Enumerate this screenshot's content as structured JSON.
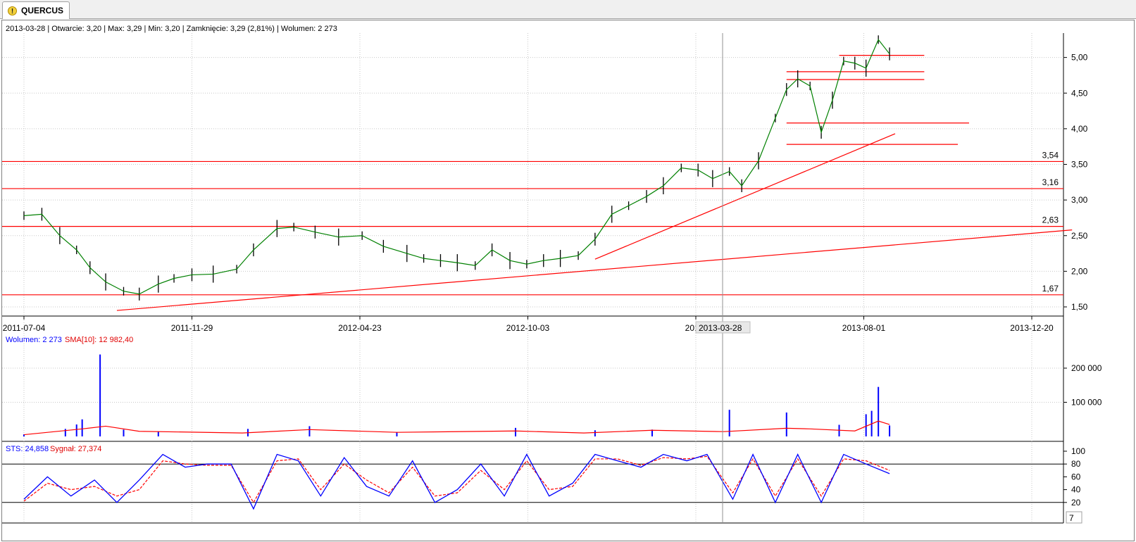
{
  "tab": {
    "label": "QUERCUS",
    "icon": "warning-icon"
  },
  "header": {
    "price": "2013-03-28 | Otwarcie: 3,20 | Max: 3,29 | Min: 3,20 | Zamknięcie: 3,29 (2,81%)  | Wolumen: 2 273",
    "volume_name": "Wolumen: 2 273",
    "volume_sma": "SMA[10]: 12 982,40",
    "sts_name": "STS: 24,858",
    "sts_signal": "Sygnał: 27,374"
  },
  "crosshair": {
    "date": "2013-03-28",
    "corner_value": "7"
  },
  "colors": {
    "candle": "#000000",
    "sma": "#008000",
    "line": "#ff0000",
    "volume": "#0000ff",
    "grid": "#c8c8c8"
  },
  "chart_data": [
    {
      "type": "line",
      "name": "price",
      "x_ticks": [
        "2011-07-04",
        "2011-11-29",
        "2012-04-23",
        "2012-10-03",
        "2013-",
        "2013-08-01",
        "2013-12-20"
      ],
      "y_ticks": [
        "1,50",
        "2,00",
        "2,50",
        "3,00",
        "3,50",
        "4,00",
        "4,50",
        "5,00"
      ],
      "ylim": [
        1.42,
        5.38
      ],
      "levels": [
        {
          "value": 3.54,
          "label": "3,54"
        },
        {
          "value": 3.16,
          "label": "3,16"
        },
        {
          "value": 2.63,
          "label": "2,63"
        },
        {
          "value": 1.67,
          "label": "1,67"
        }
      ],
      "short_levels": [
        {
          "value": 5.03,
          "from": "2013-07-01",
          "to": "2013-09-15"
        },
        {
          "value": 4.8,
          "from": "2013-05-15",
          "to": "2013-09-15"
        },
        {
          "value": 4.69,
          "from": "2013-05-15",
          "to": "2013-09-15"
        },
        {
          "value": 4.08,
          "from": "2013-05-15",
          "to": "2013-10-25"
        },
        {
          "value": 3.78,
          "from": "2013-05-15",
          "to": "2013-10-15"
        }
      ],
      "trendlines": [
        {
          "from": [
            "2011-09-25",
            1.45
          ],
          "to": [
            "2014-01-25",
            2.58
          ]
        },
        {
          "from": [
            "2012-11-25",
            2.17
          ],
          "to": [
            "2013-08-20",
            3.93
          ]
        }
      ],
      "series": [
        {
          "dates": [
            "2011-07-04",
            "2011-07-20",
            "2011-08-05",
            "2011-08-20",
            "2011-09-01",
            "2011-09-15",
            "2011-10-01",
            "2011-10-15",
            "2011-11-01",
            "2011-11-15",
            "2011-12-01",
            "2011-12-20",
            "2012-01-10",
            "2012-01-25",
            "2012-02-15",
            "2012-03-01",
            "2012-03-20",
            "2012-04-10",
            "2012-05-01",
            "2012-05-20",
            "2012-06-10",
            "2012-06-25",
            "2012-07-10",
            "2012-07-25",
            "2012-08-10",
            "2012-08-25",
            "2012-09-10",
            "2012-09-25",
            "2012-10-10",
            "2012-10-25",
            "2012-11-10",
            "2012-11-25",
            "2012-12-10",
            "2012-12-25",
            "2013-01-10",
            "2013-01-25",
            "2013-02-10",
            "2013-02-25",
            "2013-03-10",
            "2013-03-25",
            "2013-04-05",
            "2013-04-20",
            "2013-05-05",
            "2013-05-15",
            "2013-05-25",
            "2013-06-05",
            "2013-06-15",
            "2013-06-25",
            "2013-07-05",
            "2013-07-15",
            "2013-07-25",
            "2013-08-05",
            "2013-08-15"
          ],
          "values": [
            2.78,
            2.8,
            2.5,
            2.3,
            2.05,
            1.85,
            1.72,
            1.68,
            1.82,
            1.9,
            1.95,
            1.96,
            2.03,
            2.3,
            2.6,
            2.62,
            2.55,
            2.48,
            2.5,
            2.35,
            2.25,
            2.18,
            2.15,
            2.12,
            2.08,
            2.3,
            2.15,
            2.1,
            2.15,
            2.18,
            2.22,
            2.45,
            2.8,
            2.92,
            3.05,
            3.2,
            3.45,
            3.42,
            3.3,
            3.4,
            3.2,
            3.55,
            4.15,
            4.55,
            4.7,
            4.6,
            3.95,
            4.4,
            4.95,
            4.92,
            4.85,
            5.25,
            5.05
          ]
        }
      ]
    },
    {
      "type": "bar",
      "name": "Wolumen",
      "y_ticks": [
        "100 000",
        "200 000"
      ],
      "ylim": [
        0,
        240000
      ],
      "series": [
        {
          "name": "Wolumen",
          "dates": [
            "2011-07-04",
            "2011-08-10",
            "2011-08-20",
            "2011-08-25",
            "2011-09-10",
            "2011-10-01",
            "2011-11-01",
            "2012-01-20",
            "2012-03-15",
            "2012-06-01",
            "2012-09-15",
            "2012-11-25",
            "2013-01-15",
            "2013-03-25",
            "2013-05-15",
            "2013-07-01",
            "2013-07-25",
            "2013-07-30",
            "2013-08-05",
            "2013-08-15"
          ],
          "values": [
            6000,
            22000,
            35000,
            50000,
            240000,
            20000,
            15000,
            22000,
            30000,
            12000,
            25000,
            18000,
            20000,
            78000,
            70000,
            34000,
            65000,
            75000,
            145000,
            32000
          ]
        },
        {
          "name": "SMA[10]",
          "dates": [
            "2011-07-04",
            "2011-08-25",
            "2011-09-15",
            "2011-10-15",
            "2012-01-15",
            "2012-03-15",
            "2012-06-01",
            "2012-09-15",
            "2012-11-15",
            "2013-01-15",
            "2013-03-20",
            "2013-05-15",
            "2013-06-05",
            "2013-07-15",
            "2013-08-05",
            "2013-08-15"
          ],
          "values": [
            5000,
            22000,
            30000,
            15000,
            10000,
            20000,
            12000,
            16000,
            10000,
            18000,
            14000,
            24000,
            22000,
            16000,
            45000,
            35000
          ]
        }
      ]
    },
    {
      "type": "line",
      "name": "STS",
      "y_ticks": [
        "20",
        "40",
        "60",
        "80",
        "100"
      ],
      "ylim": [
        -2,
        107
      ],
      "reference_lines": [
        20,
        80
      ],
      "series": [
        {
          "name": "STS",
          "dates": [
            "2011-07-04",
            "2011-07-25",
            "2011-08-15",
            "2011-09-05",
            "2011-09-25",
            "2011-10-15",
            "2011-11-05",
            "2011-11-25",
            "2011-12-15",
            "2012-01-05",
            "2012-01-25",
            "2012-02-15",
            "2012-03-05",
            "2012-03-25",
            "2012-04-15",
            "2012-05-05",
            "2012-05-25",
            "2012-06-15",
            "2012-07-05",
            "2012-07-25",
            "2012-08-15",
            "2012-09-05",
            "2012-09-25",
            "2012-10-15",
            "2012-11-05",
            "2012-11-25",
            "2012-12-15",
            "2013-01-05",
            "2013-01-25",
            "2013-02-15",
            "2013-03-05",
            "2013-03-28",
            "2013-04-15",
            "2013-05-05",
            "2013-05-25",
            "2013-06-15",
            "2013-07-05",
            "2013-07-25",
            "2013-08-15"
          ],
          "values": [
            25,
            60,
            30,
            55,
            20,
            55,
            95,
            75,
            80,
            80,
            10,
            95,
            85,
            30,
            90,
            45,
            30,
            85,
            20,
            40,
            80,
            30,
            95,
            30,
            50,
            95,
            85,
            75,
            95,
            85,
            95,
            25,
            95,
            20,
            95,
            20,
            95,
            80,
            65
          ]
        },
        {
          "name": "Sygnał",
          "dates": [
            "2011-07-04",
            "2011-07-25",
            "2011-08-15",
            "2011-09-05",
            "2011-09-25",
            "2011-10-15",
            "2011-11-05",
            "2011-11-25",
            "2011-12-15",
            "2012-01-05",
            "2012-01-25",
            "2012-02-15",
            "2012-03-05",
            "2012-03-25",
            "2012-04-15",
            "2012-05-05",
            "2012-05-25",
            "2012-06-15",
            "2012-07-05",
            "2012-07-25",
            "2012-08-15",
            "2012-09-05",
            "2012-09-25",
            "2012-10-15",
            "2012-11-05",
            "2012-11-25",
            "2012-12-15",
            "2013-01-05",
            "2013-01-25",
            "2013-02-15",
            "2013-03-05",
            "2013-03-28",
            "2013-04-15",
            "2013-05-05",
            "2013-05-25",
            "2013-06-15",
            "2013-07-05",
            "2013-07-25",
            "2013-08-15"
          ],
          "values": [
            22,
            50,
            40,
            45,
            30,
            40,
            85,
            80,
            78,
            78,
            20,
            85,
            88,
            40,
            80,
            55,
            35,
            75,
            30,
            35,
            70,
            40,
            85,
            40,
            45,
            88,
            88,
            78,
            90,
            88,
            92,
            35,
            88,
            30,
            88,
            30,
            88,
            85,
            70
          ]
        }
      ]
    }
  ]
}
